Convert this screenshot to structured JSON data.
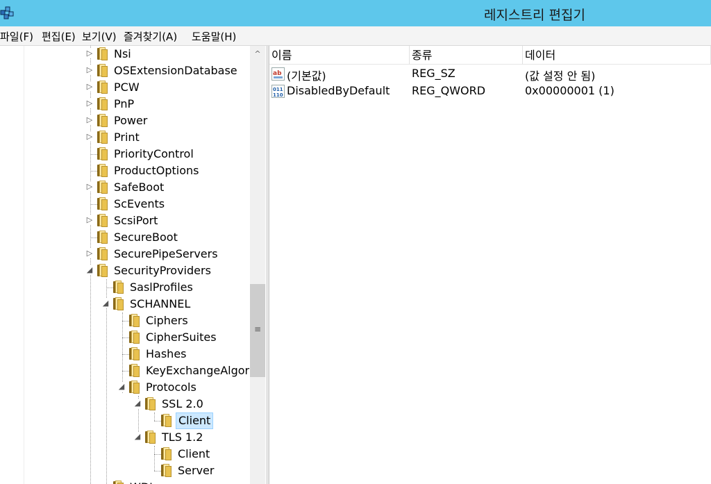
{
  "window": {
    "title": "레지스트리 편집기"
  },
  "menu": [
    {
      "label": "파일(F)"
    },
    {
      "label": "편집(E)"
    },
    {
      "label": "보기(V)"
    },
    {
      "label": "즐겨찾기(A)"
    },
    {
      "label": "도움말(H)"
    }
  ],
  "tree": {
    "items": [
      {
        "label": "Nsi",
        "expander": "collapsed"
      },
      {
        "label": "OSExtensionDatabase",
        "expander": "collapsed"
      },
      {
        "label": "PCW",
        "expander": "collapsed"
      },
      {
        "label": "PnP",
        "expander": "collapsed"
      },
      {
        "label": "Power",
        "expander": "collapsed"
      },
      {
        "label": "Print",
        "expander": "collapsed"
      },
      {
        "label": "PriorityControl",
        "expander": "none"
      },
      {
        "label": "ProductOptions",
        "expander": "none"
      },
      {
        "label": "SafeBoot",
        "expander": "collapsed"
      },
      {
        "label": "ScEvents",
        "expander": "none"
      },
      {
        "label": "ScsiPort",
        "expander": "collapsed"
      },
      {
        "label": "SecureBoot",
        "expander": "none"
      },
      {
        "label": "SecurePipeServers",
        "expander": "collapsed"
      },
      {
        "label": "SecurityProviders",
        "expander": "expanded"
      },
      {
        "label": "SaslProfiles",
        "expander": "none"
      },
      {
        "label": "SCHANNEL",
        "expander": "expanded"
      },
      {
        "label": "Ciphers",
        "expander": "none"
      },
      {
        "label": "CipherSuites",
        "expander": "none"
      },
      {
        "label": "Hashes",
        "expander": "none"
      },
      {
        "label": "KeyExchangeAlgorith",
        "expander": "none"
      },
      {
        "label": "Protocols",
        "expander": "expanded"
      },
      {
        "label": "SSL 2.0",
        "expander": "expanded"
      },
      {
        "label": "Client",
        "expander": "none",
        "selected": true
      },
      {
        "label": "TLS 1.2",
        "expander": "expanded"
      },
      {
        "label": "Client",
        "expander": "none"
      },
      {
        "label": "Server",
        "expander": "none"
      },
      {
        "label": "WDI...",
        "expander": "none"
      }
    ]
  },
  "values": {
    "columns": [
      "이름",
      "종류",
      "데이터"
    ],
    "rows": [
      {
        "icon": "string-value-icon",
        "name": "(기본값)",
        "type": "REG_SZ",
        "data": "(값 설정 안 됨)"
      },
      {
        "icon": "binary-value-icon",
        "name": "DisabledByDefault",
        "type": "REG_QWORD",
        "data": "0x00000001 (1)"
      }
    ]
  },
  "colors": {
    "titlebar": "#5ec7eb",
    "selection": "#cce8ff",
    "folder": "#e9c24f"
  }
}
